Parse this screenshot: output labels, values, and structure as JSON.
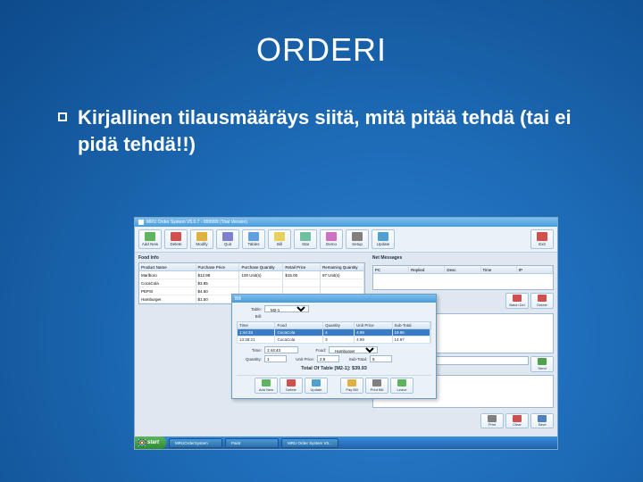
{
  "slide": {
    "title": "ORDERI",
    "bullet": "Kirjallinen tilausmääräys siitä, mitä pitää tehdä (tai ei pidä tehdä!!)"
  },
  "app": {
    "title": "MRU Order System V5.0.7 - 999999 (Trial Version)",
    "toolbar": {
      "add_new": "Add New",
      "delete": "Delete",
      "modify": "Modify",
      "quit": "Quit",
      "tables": "Tables",
      "bill": "Bill",
      "stat": "Stat",
      "demo": "Demo",
      "setup": "Setup",
      "update": "Update",
      "exit": "Exit"
    },
    "food_info_label": "Food Info",
    "food_table": {
      "headers": {
        "name": "Product Name",
        "purchase": "Purchase Price",
        "qty": "Purchase Quantity",
        "retail": "Retail Price",
        "remain": "Remaining Quantity"
      },
      "rows": [
        {
          "name": "Marlboro",
          "purchase": "$12.98",
          "qty": "100 Unit(s)",
          "retail": "$15.00",
          "remain": "97 Unit(s)"
        },
        {
          "name": "CocaCola",
          "purchase": "$3.85",
          "qty": "",
          "retail": "",
          "remain": ""
        },
        {
          "name": "PEPSI",
          "purchase": "$4.50",
          "qty": "",
          "retail": "",
          "remain": ""
        },
        {
          "name": "Hamburger",
          "purchase": "$1.50",
          "qty": "",
          "retail": "",
          "remain": ""
        }
      ]
    },
    "net_label": "Net Messages",
    "net_table": {
      "headers": {
        "pc": "PC",
        "replied": "Replied",
        "desc": "Desc",
        "time": "Time",
        "ip": "IP"
      }
    },
    "right_buttons": {
      "batch_del": "Batch Del",
      "delete": "Delete"
    },
    "send_button": "Send",
    "bottom_buttons": {
      "print": "Print",
      "clear": "Clear",
      "save": "Save"
    },
    "bill": {
      "title": "Bill",
      "table_label": "Table:",
      "table_value": "M2-1",
      "bill_label": "Bill:",
      "headers": {
        "time": "Time",
        "food": "Food",
        "qty": "Quantity",
        "unit": "Unit Price",
        "sub": "Sub-Total"
      },
      "rows": [
        {
          "time": "1:44:33",
          "food": "CocaCola",
          "qty": "4",
          "unit": "4.99",
          "sub": "19.96"
        },
        {
          "time": "13:38:21",
          "food": "CocaCola",
          "qty": "3",
          "unit": "4.99",
          "sub": "14.97"
        }
      ],
      "time_label": "Time:",
      "time_value": "1:44:43",
      "food_label": "Food:",
      "food_value": "Hamburger",
      "qty_label": "Quantity:",
      "qty_value": "1",
      "unit_label": "Unit Price:",
      "unit_value": "2.5",
      "sub_label": "Sub-Total:",
      "sub_value": "5",
      "total": "Total Of Table [M2-1]: $39.93",
      "buttons": {
        "add_new": "Add New",
        "delete": "Delete",
        "update": "Update",
        "pay": "Pay Bill",
        "print": "Print Bill",
        "leave": "Leave"
      }
    }
  },
  "taskbar": {
    "start": "start",
    "items": [
      "MRUOrderSystem",
      "Paint",
      "MRU Order System V5..."
    ]
  },
  "icon_colors": {
    "add": "#5fb45f",
    "delete": "#d05050",
    "modify": "#e0b040",
    "quit": "#8080d0",
    "tables": "#60a0e0",
    "bill": "#e8d060",
    "stat": "#70c0a0",
    "demo": "#d070c0",
    "setup": "#808080",
    "update": "#50a0d0",
    "exit": "#d05050",
    "pay": "#e0b040",
    "print": "#808080",
    "leave": "#5fb45f",
    "clear": "#d05050",
    "save": "#5080c0",
    "send": "#50a050"
  }
}
